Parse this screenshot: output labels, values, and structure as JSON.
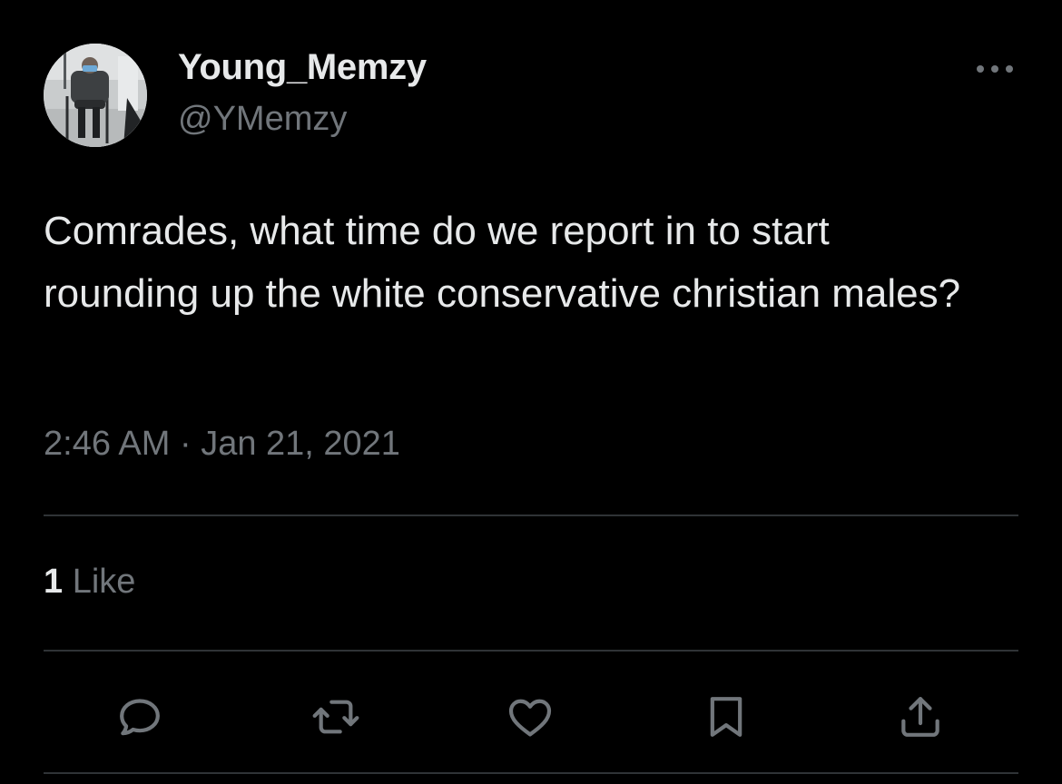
{
  "author": {
    "display_name": "Young_Memzy",
    "handle": "@YMemzy"
  },
  "tweet": {
    "text": "Comrades, what time do we report in to start rounding up the white conservative christian males?",
    "timestamp": "2:46 AM · Jan 21, 2021"
  },
  "stats": {
    "likes_count": "1",
    "likes_label": "Like"
  },
  "actions": {
    "reply": "reply-icon",
    "retweet": "retweet-icon",
    "like": "heart-icon",
    "bookmark": "bookmark-icon",
    "share": "share-icon"
  },
  "colors": {
    "background": "#000000",
    "primary_text": "#e7e9ea",
    "secondary_text": "#71767b",
    "divider": "#2f3336"
  }
}
